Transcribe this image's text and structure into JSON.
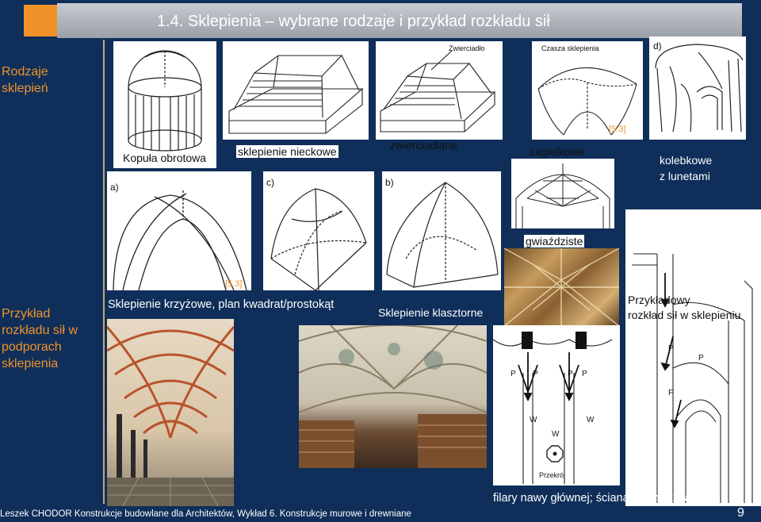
{
  "header": {
    "title": "1.4. Sklepienia – wybrane rodzaje i przykład  rozkładu sił"
  },
  "side": {
    "types_label_1": "Rodzaje",
    "types_label_2": "sklepień",
    "forces_label_1": "Przykład",
    "forces_label_2": "rozkładu sił w",
    "forces_label_3": "podporach",
    "forces_label_4": "sklepienia"
  },
  "figures": {
    "dome": "Kopuła obrotowa",
    "trough": "sklepienie nieckowe",
    "mirror": "zwierciadlane",
    "mirror_label": "Zwierciadło",
    "sail": "żagielkowe",
    "sail_label": "Czasza sklepienia",
    "ref_top": "[5.3]",
    "barrel_1": "kolebkowe",
    "barrel_2": "z lunetami",
    "letter_d": "d)",
    "letter_a": "a)",
    "letter_c": "c)",
    "letter_b": "b)",
    "star": "gwiaździste",
    "ref_mid": "[5.3]",
    "cross": "Sklepienie krzyżowe, plan kwadrat/prostokąt",
    "cloister": "Sklepienie klasztorne",
    "forces_1": "Przykładowy",
    "forces_2": "rozkład sił w sklepieniu",
    "pillars": "filary nawy głównej; ściana zewnętrzna",
    "section": "Przekrój",
    "force_P": "P",
    "force_W": "W",
    "force_F": "F"
  },
  "footer": {
    "text": "Leszek CHODOR   Konstrukcje budowlane dla Architektów, Wykład 6. Konstrukcje murowe i drewniane",
    "page": "9"
  }
}
